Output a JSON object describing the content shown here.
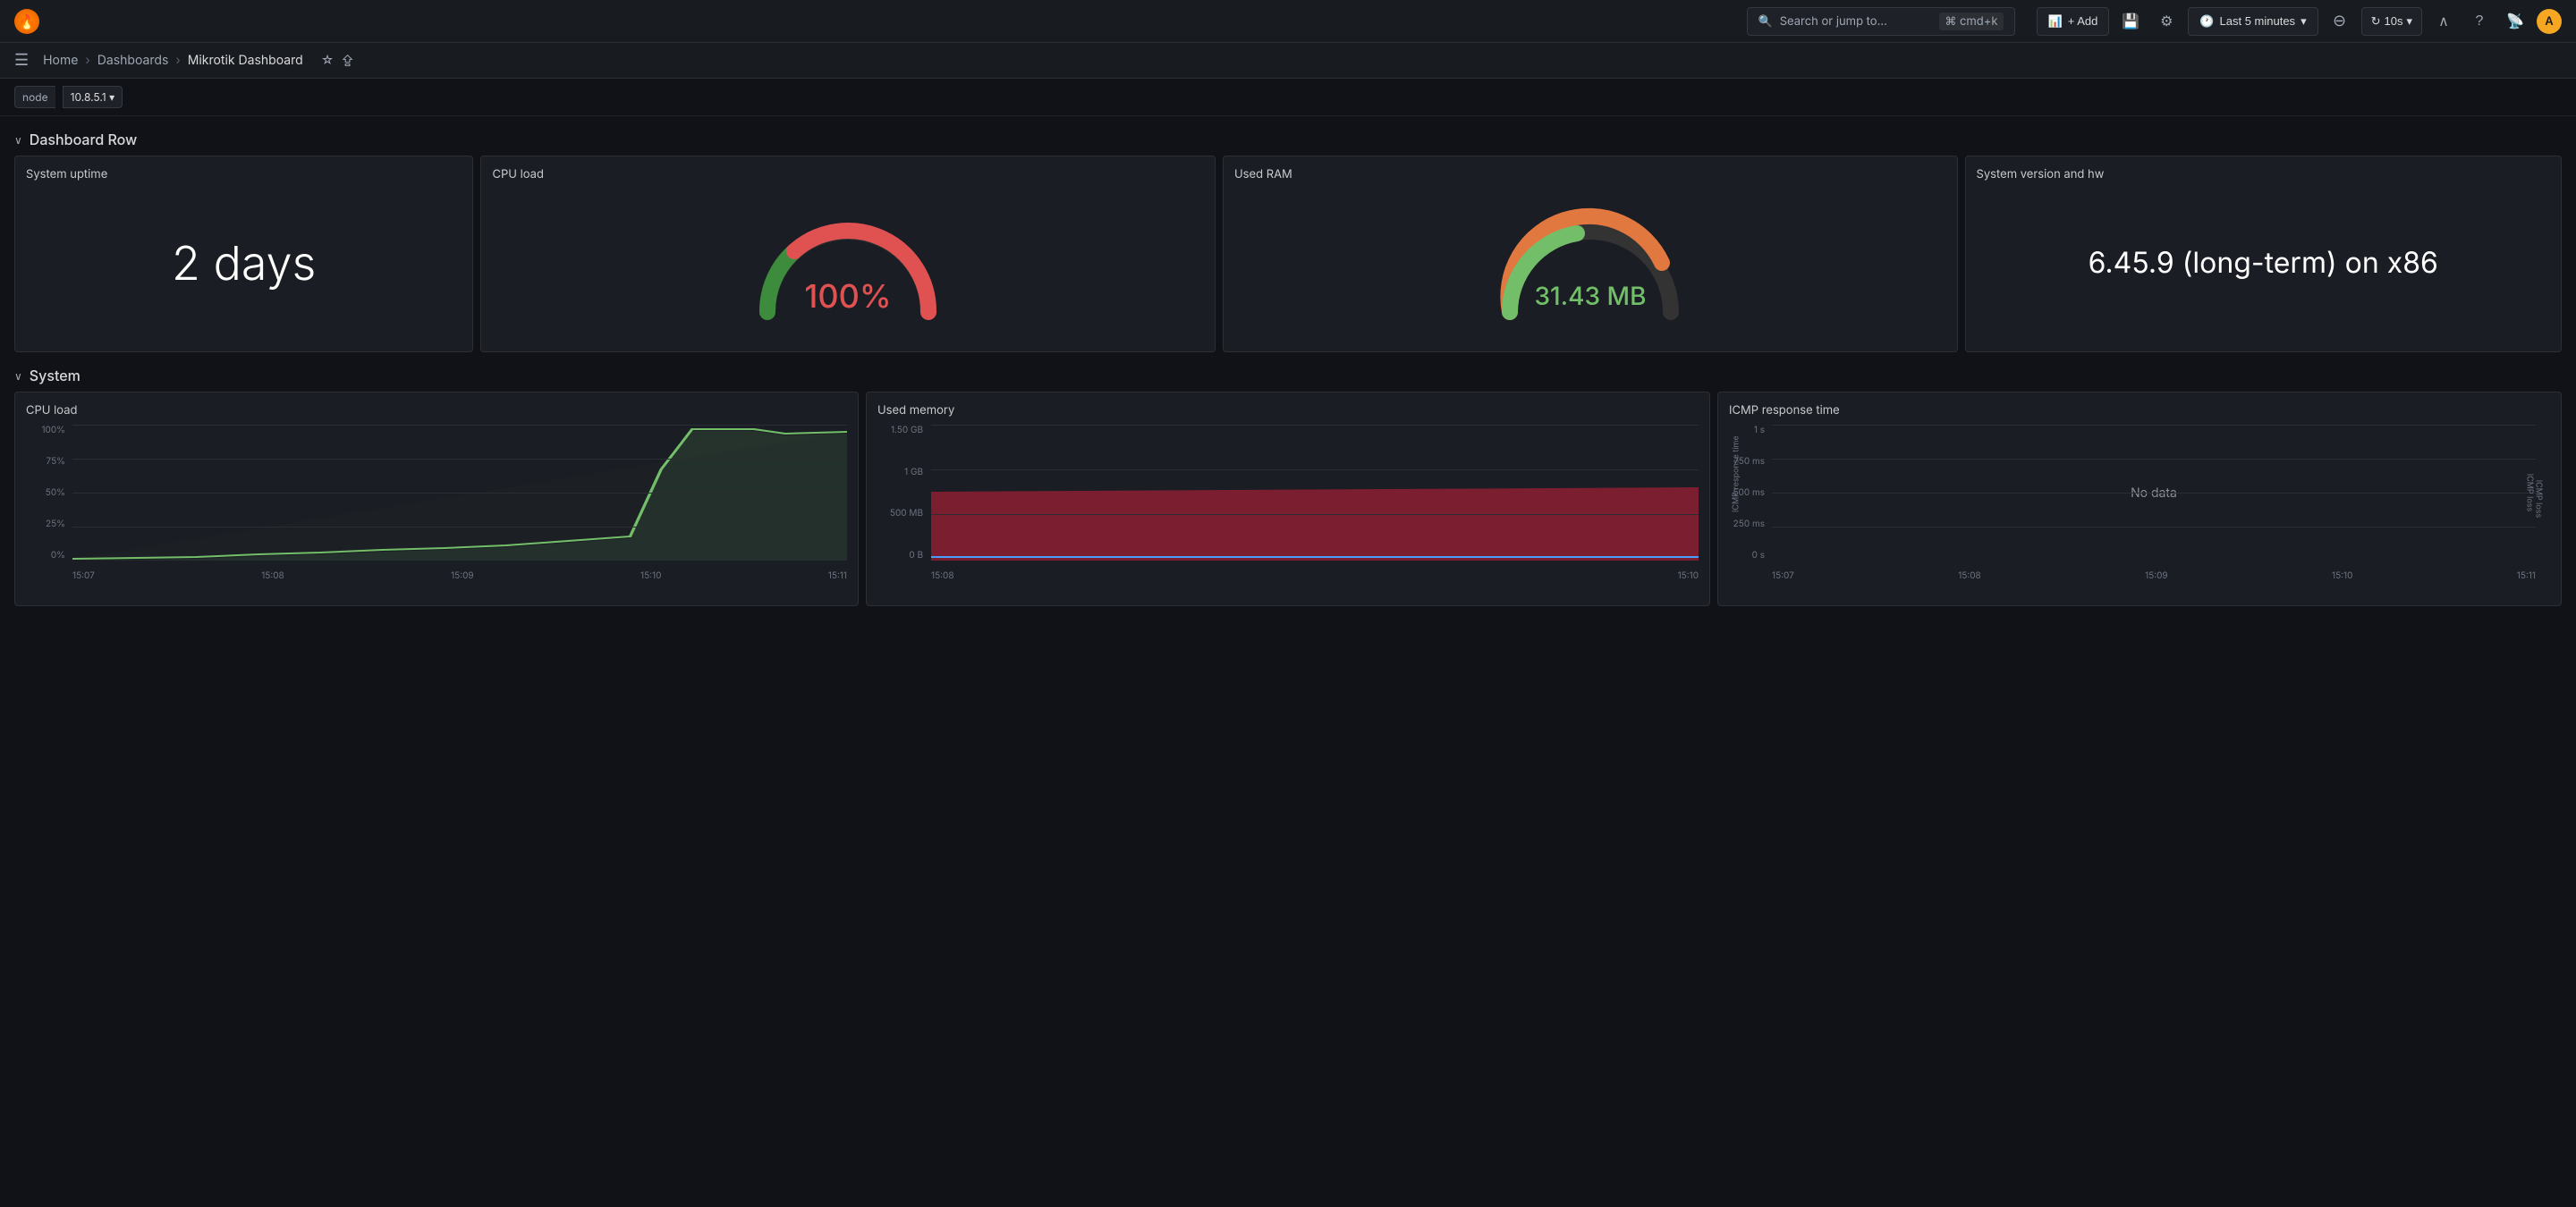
{
  "app": {
    "logo": "🔥",
    "name": "Grafana"
  },
  "topnav": {
    "search_placeholder": "Search or jump to...",
    "search_kbd": "⌘ cmd+k",
    "add_btn": "+ Add",
    "time_range": "Last 5 minutes",
    "refresh_interval": "10s",
    "icons": {
      "plus": "+",
      "help": "?",
      "rss": "📡",
      "save": "💾",
      "settings": "⚙",
      "zoom_out": "⊖",
      "refresh": "↻",
      "collapse": "∧"
    }
  },
  "breadcrumb": {
    "hamburger": "☰",
    "items": [
      "Home",
      "Dashboards",
      "Mikrotik Dashboard"
    ],
    "separator": "›",
    "star_icon": "☆",
    "share_icon": "⇪"
  },
  "variables": {
    "node_label": "node",
    "node_value": "10.8.5.1 ▾"
  },
  "dashboard_row": {
    "label": "Dashboard Row",
    "chevron": "∨"
  },
  "system_row": {
    "label": "System",
    "chevron": "∨"
  },
  "panels": {
    "system_uptime": {
      "title": "System uptime",
      "value": "2 days"
    },
    "cpu_load_gauge": {
      "title": "CPU load",
      "value": "100%",
      "color": "#e05252"
    },
    "used_ram": {
      "title": "Used RAM",
      "value": "31.43 MB",
      "color": "#73bf69"
    },
    "system_version": {
      "title": "System version and hw",
      "value": "6.45.9 (long-term) on x86"
    },
    "cpu_load_chart": {
      "title": "CPU load",
      "y_labels": [
        "100%",
        "75%",
        "50%",
        "25%",
        "0%"
      ],
      "x_labels": [
        "15:07",
        "15:08",
        "15:09",
        "15:10",
        "15:11"
      ],
      "line_color": "#73bf69"
    },
    "used_memory": {
      "title": "Used memory",
      "y_labels": [
        "1.50 GB",
        "1 GB",
        "500 MB",
        "0 B"
      ],
      "x_labels": [
        "15:08",
        "15:10"
      ],
      "fill_color": "#a0233a"
    },
    "icmp_response": {
      "title": "ICMP response time",
      "y_labels": [
        "1 s",
        "750 ms",
        "500 ms",
        "250 ms",
        "0 s"
      ],
      "x_labels": [
        "15:07",
        "15:08",
        "15:09",
        "15:10",
        "15:11"
      ],
      "no_data": "No data",
      "y_axis_label": "ICMP response time",
      "y2_axis_label": "ICMP loss"
    }
  }
}
